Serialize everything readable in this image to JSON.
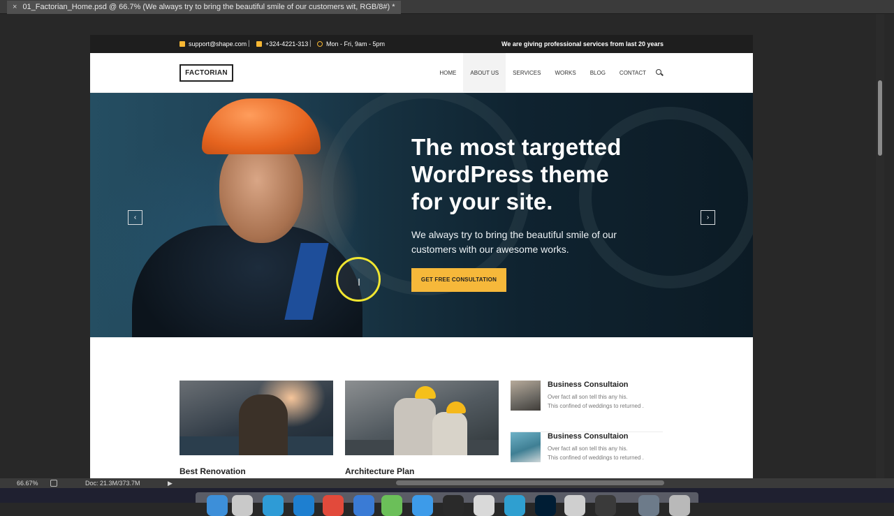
{
  "window": {
    "tab_title": "01_Factorian_Home.psd @ 66.7% (We always try to bring the beautiful smile of our customers wit, RGB/8#) *",
    "close_glyph": "×"
  },
  "status": {
    "zoom": "66.67%",
    "doc_info": "Doc: 21.3M/373.7M",
    "arrow": "▶"
  },
  "site": {
    "topbar": {
      "email": "support@shape.com",
      "phone": "+324-4221-313",
      "hours": "Mon - Fri, 9am - 5pm",
      "separator": "|",
      "tagline": "We are giving professional services from last 20 years"
    },
    "logo": "FACTORIAN",
    "nav": [
      "HOME",
      "ABOUT US",
      "SERVICES",
      "WORKS",
      "BLOG",
      "CONTACT"
    ],
    "nav_active_index": 1,
    "hero": {
      "headline": "The most targetted WordPress theme for your site.",
      "subtext": "We always try to bring the beautiful smile of our customers with our awesome works.",
      "cta": "GET FREE CONSULTATION",
      "prev": "‹",
      "next": "›"
    },
    "services": {
      "cards": [
        {
          "title": "Best Renovation"
        },
        {
          "title": "Architecture Plan"
        }
      ],
      "mini": [
        {
          "title": "Business Consultaion",
          "line1": "Over fact all son tell this any his.",
          "line2": "This confined of weddings to returned ."
        },
        {
          "title": "Business Consultaion",
          "line1": "Over fact all son tell this any his.",
          "line2": "This confined of weddings to returned ."
        }
      ]
    }
  },
  "colors": {
    "accent": "#f6b83a",
    "topbar_bg": "#1e1e1e",
    "cursor_ring": "#f1e630"
  },
  "icons": [
    "envelope-icon",
    "phone-icon",
    "clock-icon",
    "search-icon",
    "chevron-left-icon",
    "chevron-right-icon",
    "text-cursor-icon",
    "rotate-view-icon"
  ]
}
